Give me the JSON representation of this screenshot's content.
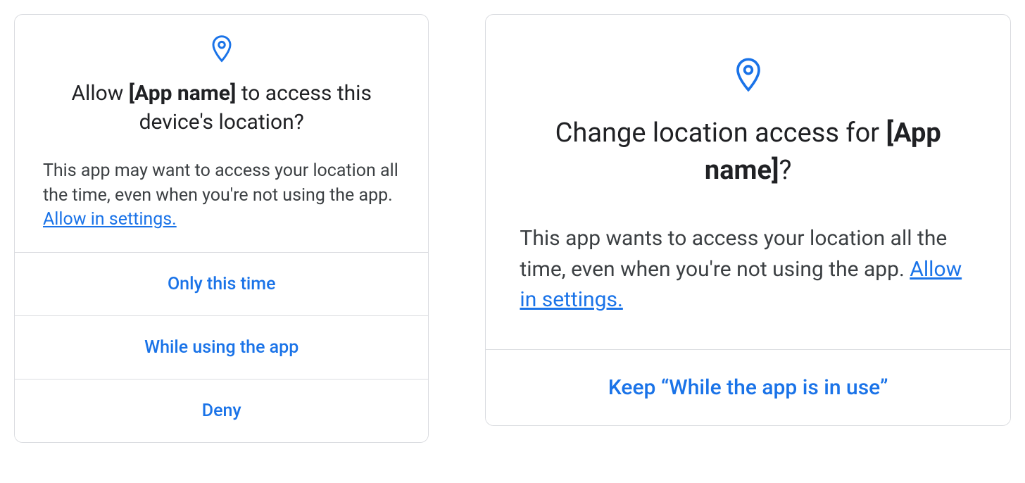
{
  "dialogs": [
    {
      "title_prefix": "Allow ",
      "title_app": "[App name]",
      "title_suffix": " to access this device's location?",
      "body_text": "This app may want to access your location all the time, even when you're not using the app. ",
      "body_link": "Allow in settings.",
      "buttons": [
        "Only this time",
        "While using the app",
        "Deny"
      ]
    },
    {
      "title_prefix": "Change location access for ",
      "title_app": "[App name]",
      "title_suffix": "?",
      "body_text": "This app wants to access your location all the time, even when you're not using the app. ",
      "body_link": "Allow in settings.",
      "buttons": [
        "Keep “While the app is in use”"
      ]
    }
  ],
  "colors": {
    "accent": "#1a73e8",
    "text_primary": "#202124",
    "text_secondary": "#3c4043",
    "divider": "#dadce0"
  }
}
